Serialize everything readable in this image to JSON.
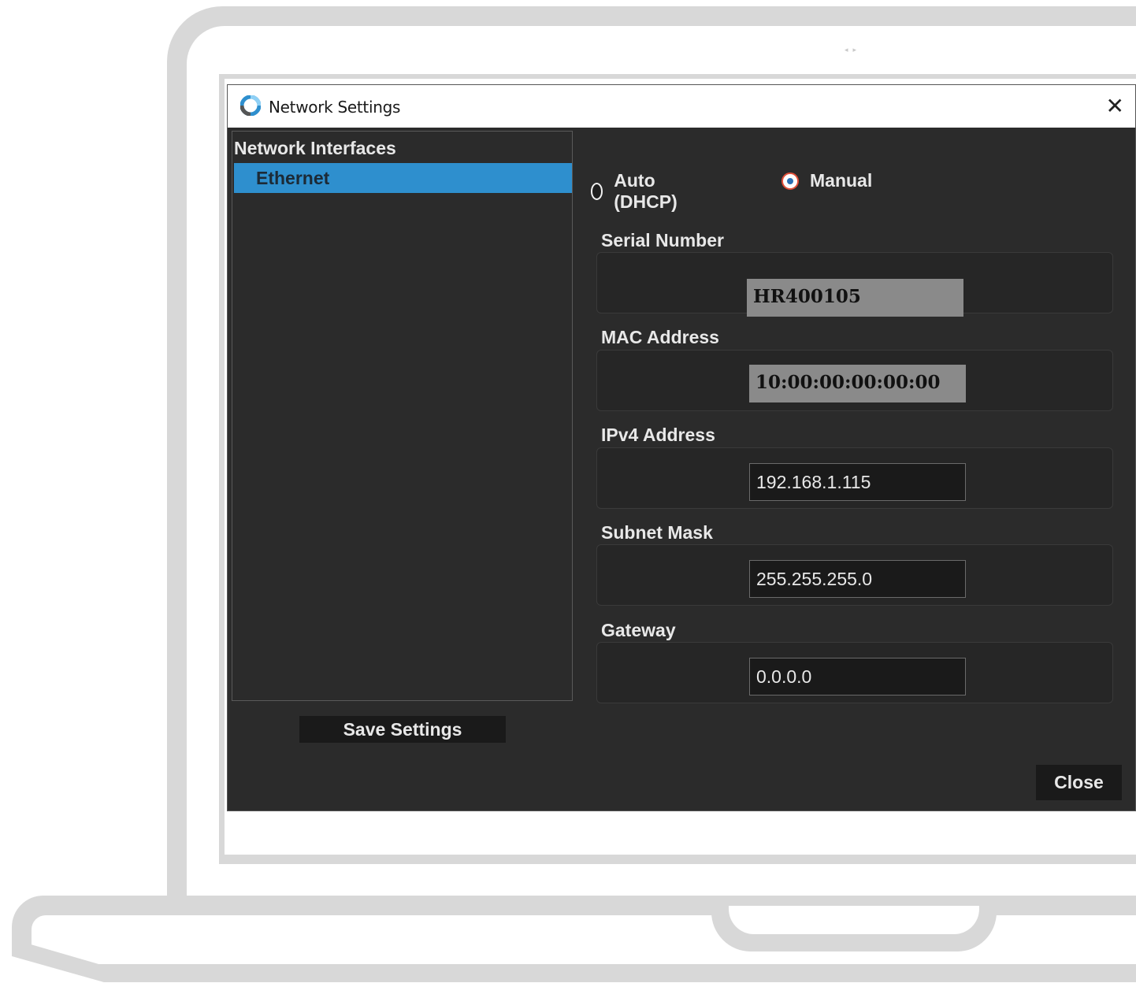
{
  "window": {
    "title": "Network Settings",
    "close_glyph": "✕"
  },
  "interfaces": {
    "header": "Network Interfaces",
    "items": [
      {
        "label": "Ethernet",
        "selected": true
      }
    ]
  },
  "mode": {
    "options": [
      {
        "label": "Auto (DHCP)",
        "checked": false
      },
      {
        "label": "Manual",
        "checked": true
      }
    ]
  },
  "fields": {
    "serial": {
      "label": "Serial Number",
      "value": "HR400105"
    },
    "mac": {
      "label": "MAC Address",
      "value": "10:00:00:00:00:00"
    },
    "ipv4": {
      "label": "IPv4 Address",
      "value": "192.168.1.115"
    },
    "subnet": {
      "label": "Subnet Mask",
      "value": "255.255.255.0"
    },
    "gateway": {
      "label": "Gateway",
      "value": "0.0.0.0"
    }
  },
  "buttons": {
    "save": "Save Settings",
    "close": "Close"
  },
  "colors": {
    "selection": "#2e8fce",
    "dialog_bg": "#2b2b2b",
    "frame": "#d8d8d8",
    "radio_accent": "#e0503a"
  }
}
